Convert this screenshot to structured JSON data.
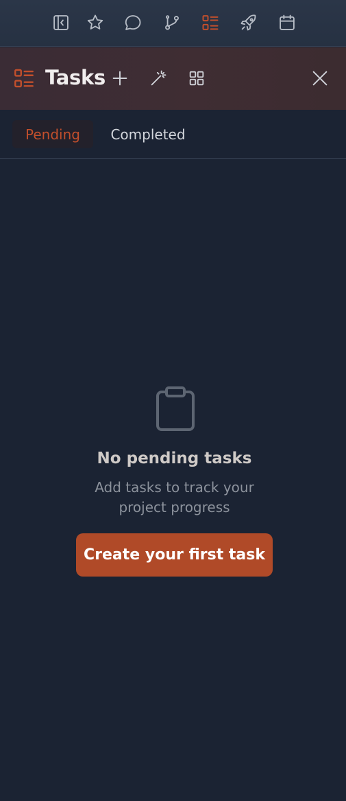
{
  "colors": {
    "accent": "#c24f2c",
    "button": "#b04a28",
    "background": "#1b2333",
    "icon_muted": "#b7bdc6"
  },
  "toolbar": {
    "icons": [
      {
        "name": "sidebar-collapse-icon",
        "active": false
      },
      {
        "name": "star-icon",
        "active": false
      },
      {
        "name": "chat-icon",
        "active": false
      },
      {
        "name": "git-branch-icon",
        "active": false
      },
      {
        "name": "tasks-list-icon",
        "active": true
      },
      {
        "name": "rocket-icon",
        "active": false
      },
      {
        "name": "calendar-icon",
        "active": false
      }
    ]
  },
  "header": {
    "title": "Tasks",
    "icon": "tasks-list-icon",
    "actions": [
      "plus-icon",
      "magic-wand-icon",
      "grid-icon"
    ],
    "close_icon": "close-icon"
  },
  "tabs": [
    {
      "label": "Pending",
      "active": true
    },
    {
      "label": "Completed",
      "active": false
    }
  ],
  "empty_state": {
    "icon": "clipboard-icon",
    "title": "No pending tasks",
    "description": "Add tasks to track your project progress",
    "button_label": "Create your first task"
  }
}
